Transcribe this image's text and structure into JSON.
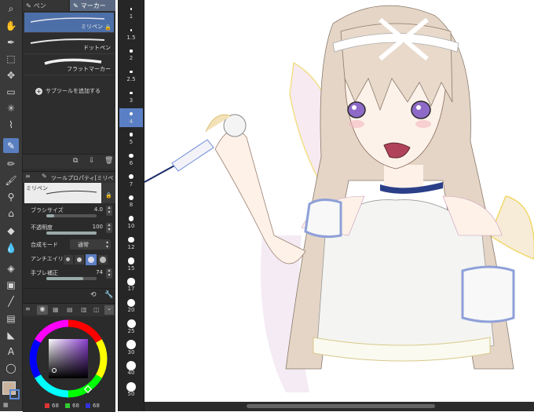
{
  "subtool": {
    "tab_pen": "ペン",
    "tab_marker": "マーカー",
    "brushes": [
      {
        "label": "ミリペン",
        "selected": true
      },
      {
        "label": "ドットペン",
        "selected": false
      },
      {
        "label": "フラットマーカー",
        "selected": false
      }
    ],
    "add_subtool": "サブツールを追加する"
  },
  "toolprop": {
    "title": "ツールプロパティ[ミリペ",
    "brush_name": "ミリペン",
    "rows": [
      {
        "label": "ブラシサイズ",
        "value": "4.0"
      },
      {
        "label": "不透明度",
        "value": "100"
      },
      {
        "label": "合成モード",
        "value": "通常"
      },
      {
        "label": "アンチエイリ",
        "value": ""
      },
      {
        "label": "手ブレ補正",
        "value": "74"
      }
    ],
    "brush_size_fraction": 0.15,
    "opacity_fraction": 1.0,
    "stabilizer_fraction": 0.74
  },
  "color": {
    "main_color": "#c9b29c",
    "sub_color": "#ffffff",
    "hue_color": "#8a3fd0",
    "rgb": {
      "r": "68",
      "g": "68",
      "b": "68"
    }
  },
  "sizes": [
    "1",
    "1.5",
    "2",
    "2.5",
    "3",
    "4",
    "5",
    "6",
    "7",
    "8",
    "10",
    "12",
    "15",
    "17",
    "20",
    "25",
    "30",
    "40",
    "50"
  ],
  "selected_size": "4",
  "tools": [
    "magnifier-icon",
    "hand-icon",
    "pen-nib-icon",
    "object-icon",
    "move-icon",
    "selection-icon",
    "magic-wand-icon",
    "eyedropper-icon",
    "pen-icon",
    "pencil-icon",
    "brush-icon",
    "airbrush-icon",
    "decoration-icon",
    "eraser-icon",
    "blend-icon",
    "fill-icon",
    "gradient-icon",
    "line-icon",
    "frame-icon",
    "ruler-icon",
    "text-icon",
    "balloon-icon"
  ]
}
